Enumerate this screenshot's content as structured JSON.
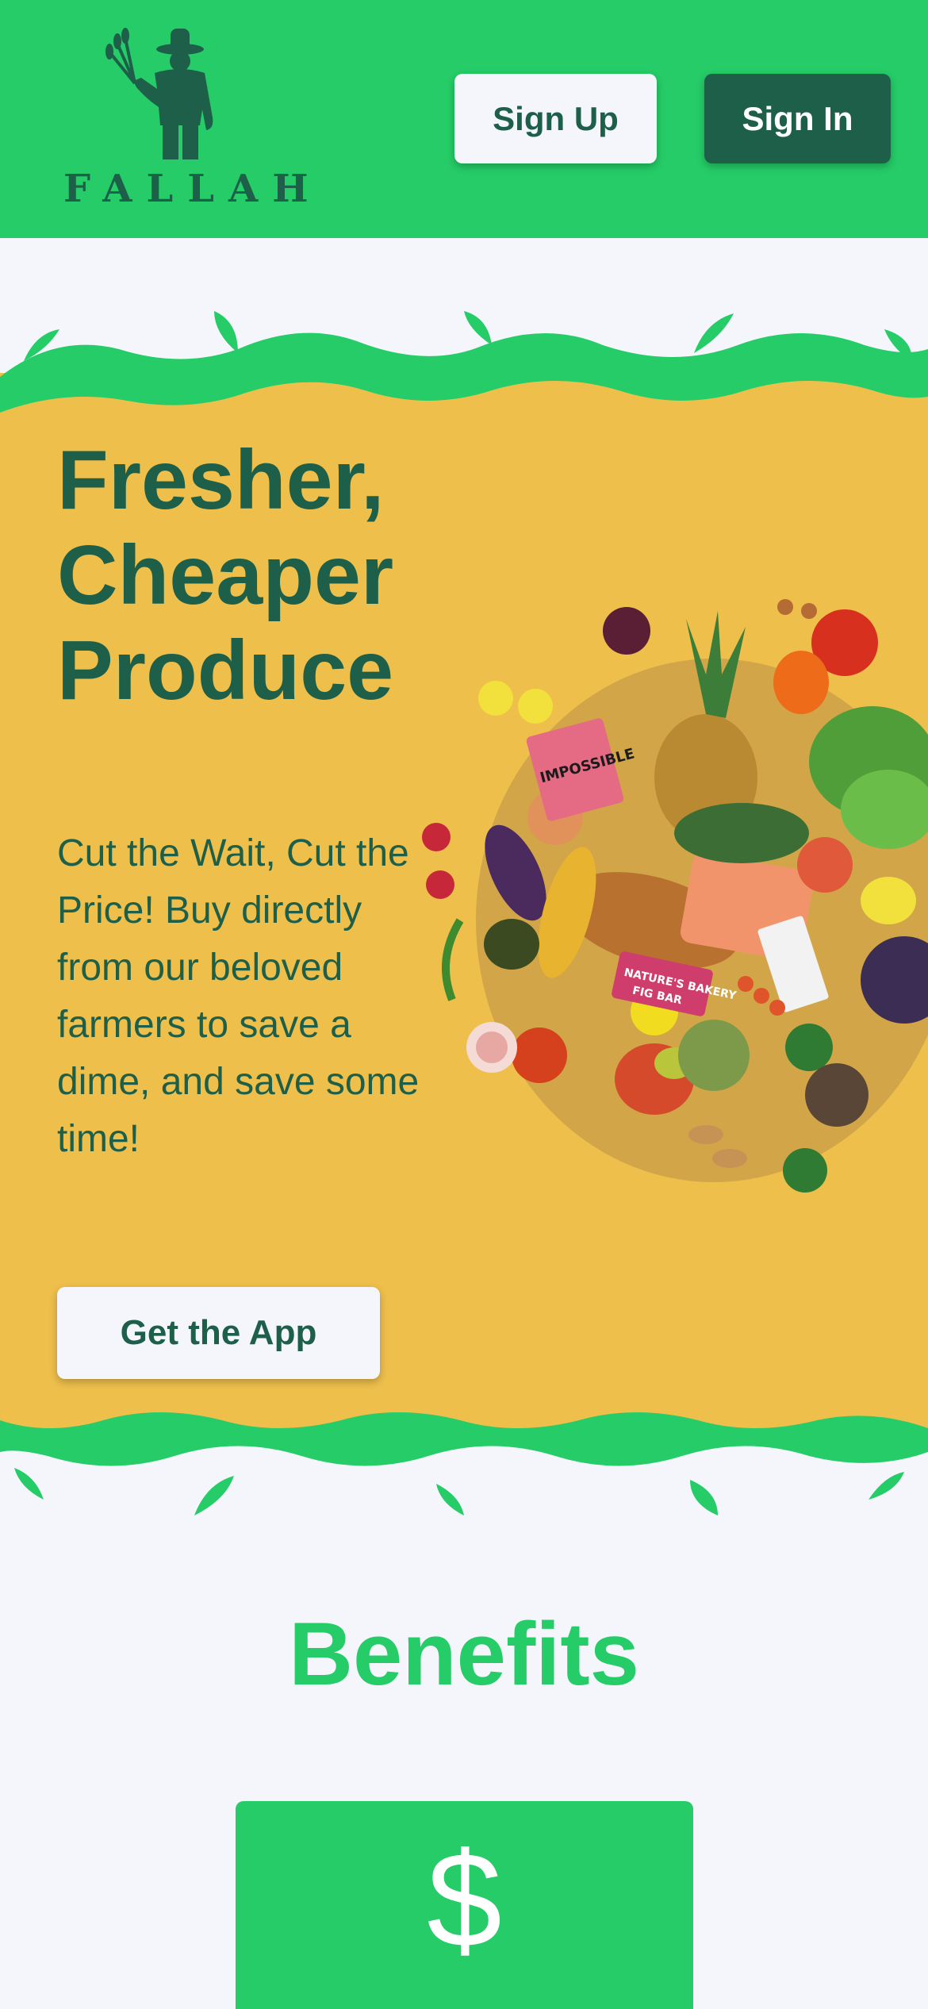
{
  "brand": {
    "name": "FALLAH",
    "logo_icon": "farmer-holding-wheat-icon"
  },
  "header": {
    "signup_label": "Sign Up",
    "signin_label": "Sign In"
  },
  "hero": {
    "title_lines": [
      "Fresher,",
      "Cheaper",
      "Produce"
    ],
    "description": "Cut the Wait, Cut the Price! Buy directly from our beloved farmers to save a dime, and save some time!",
    "cta_label": "Get the App",
    "image": "assorted-groceries-produce-image",
    "product_labels": [
      "IMPOSSIBLE",
      "NATURE'S BAKERY",
      "FIG BAR"
    ]
  },
  "benefits": {
    "title": "Benefits",
    "cards": [
      {
        "icon": "dollar-icon",
        "symbol": "$"
      }
    ]
  },
  "colors": {
    "primary_green": "#25cc67",
    "dark_green": "#1e5f4a",
    "hero_yellow": "#efbf4c",
    "background": "#f4f6fb"
  }
}
